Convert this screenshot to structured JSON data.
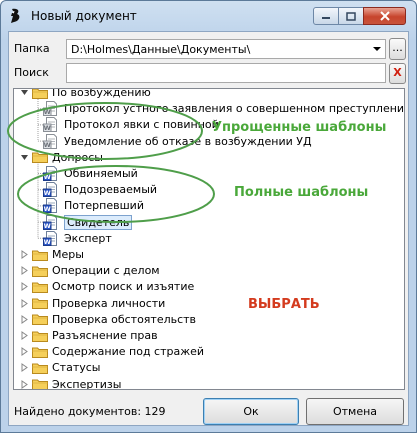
{
  "window": {
    "title": "Новый документ"
  },
  "folder": {
    "label": "Папка",
    "path": "D:\\Holmes\\Данные\\Документы\\",
    "browse_label": "..."
  },
  "search": {
    "label": "Поиск",
    "value": "",
    "placeholder": "",
    "clear_label": "X"
  },
  "tree": {
    "groups": [
      {
        "label": "По возбуждению",
        "expanded": true,
        "items": [
          "Протокол устного заявления о совершенном преступлении",
          "Протокол явки с повинной",
          "Уведомление об отказе в возбуждении УД"
        ]
      },
      {
        "label": "Допросы",
        "expanded": true,
        "items": [
          "Обвиняемый",
          "Подозреваемый",
          "Потерпевший",
          "Свидетель",
          "Эксперт"
        ]
      },
      {
        "label": "Меры",
        "expanded": false
      },
      {
        "label": "Операции с делом",
        "expanded": false
      },
      {
        "label": "Осмотр поиск и изъятие",
        "expanded": false
      },
      {
        "label": "Проверка личности",
        "expanded": false
      },
      {
        "label": "Проверка обстоятельств",
        "expanded": false
      },
      {
        "label": "Разъяснение прав",
        "expanded": false
      },
      {
        "label": "Содержание под стражей",
        "expanded": false
      },
      {
        "label": "Статусы",
        "expanded": false
      },
      {
        "label": "Экспертизы",
        "expanded": false
      }
    ],
    "selected_item": "Свидетель"
  },
  "annotations": {
    "simplified": "Упрощенные шаблоны",
    "full": "Полные шаблоны",
    "choose": "ВЫБРАТЬ"
  },
  "footer": {
    "found_label": "Найдено документов: 129"
  },
  "buttons": {
    "ok": "Ок",
    "cancel": "Отмена"
  },
  "colors": {
    "annotation_green": "#4aa83a",
    "annotation_red": "#d43b1e",
    "ellipse": "#4f9e4a",
    "selection": "#dcecfc"
  }
}
